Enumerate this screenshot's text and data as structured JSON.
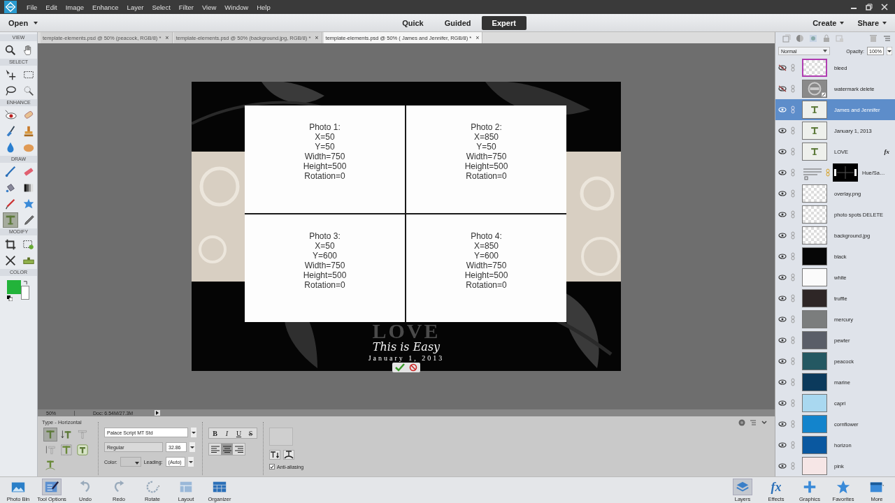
{
  "menu_bar": {
    "items": [
      "File",
      "Edit",
      "Image",
      "Enhance",
      "Layer",
      "Select",
      "Filter",
      "View",
      "Window",
      "Help"
    ]
  },
  "mode_bar": {
    "open": "Open",
    "modes": [
      {
        "label": "Quick",
        "selected": false
      },
      {
        "label": "Guided",
        "selected": false
      },
      {
        "label": "Expert",
        "selected": true
      }
    ],
    "create": "Create",
    "share": "Share"
  },
  "toolbox": {
    "sections": [
      {
        "title": "VIEW",
        "tools": [
          {
            "kind": "zoom",
            "selected": false
          },
          {
            "kind": "hand",
            "selected": false
          }
        ]
      },
      {
        "title": "SELECT",
        "tools": [
          {
            "kind": "move",
            "selected": false
          },
          {
            "kind": "marquee",
            "selected": false
          },
          {
            "kind": "lasso",
            "selected": false
          },
          {
            "kind": "quick-select",
            "selected": false
          }
        ]
      },
      {
        "title": "ENHANCE",
        "tools": [
          {
            "kind": "red-eye",
            "selected": false
          },
          {
            "kind": "spot-heal",
            "selected": false
          },
          {
            "kind": "smart-brush",
            "selected": false
          },
          {
            "kind": "clone-stamp",
            "selected": false
          },
          {
            "kind": "blur",
            "selected": false
          },
          {
            "kind": "sponge",
            "selected": false
          }
        ]
      },
      {
        "title": "DRAW",
        "tools": [
          {
            "kind": "brush",
            "selected": false
          },
          {
            "kind": "eraser",
            "selected": false
          },
          {
            "kind": "paint-bucket",
            "selected": false
          },
          {
            "kind": "gradient",
            "selected": false
          },
          {
            "kind": "eyedropper",
            "selected": false
          },
          {
            "kind": "custom-shape",
            "selected": false
          },
          {
            "kind": "type",
            "selected": true
          },
          {
            "kind": "pencil",
            "selected": false
          }
        ]
      },
      {
        "title": "MODIFY",
        "tools": [
          {
            "kind": "crop",
            "selected": false
          },
          {
            "kind": "recompose",
            "selected": false
          },
          {
            "kind": "content-move",
            "selected": false
          },
          {
            "kind": "straighten",
            "selected": false
          }
        ]
      }
    ],
    "color_title": "COLOR",
    "swatches": [
      {
        "kind": "foreground",
        "color": "#22b33a"
      },
      {
        "kind": "background",
        "color": "#ffffff"
      }
    ]
  },
  "document_tabs": [
    {
      "label": "template-elements.psd @ 50% (peacock, RGB/8) *",
      "close": "×",
      "selected": false
    },
    {
      "label": "template-elements.psd @ 50% (background.jpg, RGB/8) *",
      "close": "×",
      "selected": false
    },
    {
      "label": "template-elements.psd @ 50% ( James and Jennifer, RGB/8) *",
      "close": "×",
      "selected": true
    }
  ],
  "canvas": {
    "photo_spots": [
      {
        "lines": [
          "Photo 1:",
          "X=50",
          "Y=50",
          "Width=750",
          "Height=500",
          "Rotation=0"
        ]
      },
      {
        "lines": [
          "Photo 2:",
          "X=850",
          "Y=50",
          "Width=750",
          "Height=500",
          "Rotation=0"
        ]
      },
      {
        "lines": [
          "Photo 3:",
          "X=50",
          "Y=600",
          "Width=750",
          "Height=500",
          "Rotation=0"
        ]
      },
      {
        "lines": [
          "Photo 4:",
          "X=850",
          "Y=600",
          "Width=750",
          "Height=500",
          "Rotation=0"
        ]
      }
    ],
    "title_text": "LOVE",
    "script_text": "This is Easy",
    "date_text": "January 1, 2013"
  },
  "status": {
    "zoom": "50%",
    "doc": "Doc: 6.54M/27.3M"
  },
  "tool_options": {
    "title": "Type - Horizontal",
    "type_tools": [
      {
        "kind": "horizontal",
        "selected": true
      },
      {
        "kind": "vertical",
        "selected": false
      },
      {
        "kind": "horizontal-mask",
        "selected": false
      },
      {
        "kind": "vertical-mask",
        "selected": false
      },
      {
        "kind": "on-selection",
        "selected": false
      },
      {
        "kind": "on-shape",
        "selected": false
      },
      {
        "kind": "on-path",
        "selected": false
      }
    ],
    "font": "Palace Script MT Std",
    "style": "Regular",
    "size": "32.86",
    "styles": [
      {
        "label": "B",
        "selected": false
      },
      {
        "label": "I",
        "selected": false
      },
      {
        "label": "U",
        "selected": false
      },
      {
        "label": "S",
        "selected": false
      }
    ],
    "alignments": [
      {
        "kind": "left",
        "selected": false
      },
      {
        "kind": "center",
        "selected": true
      },
      {
        "kind": "right",
        "selected": false
      }
    ],
    "color_label": "Color:",
    "leading_label": "Leading:",
    "leading": "(Auto)",
    "anti_aliasing": {
      "label": "Anti-aliasing",
      "checked": true
    }
  },
  "layers_panel": {
    "blend_mode": "Normal",
    "opacity_label": "Opacity:",
    "opacity": "100%",
    "layers": [
      {
        "name": "bleed",
        "kind": "outlined",
        "visible": false,
        "selected": false
      },
      {
        "name": "watermark delete",
        "kind": "smart-object",
        "visible": false,
        "selected": false
      },
      {
        "name": "James and Jennifer",
        "kind": "text",
        "visible": true,
        "selected": true
      },
      {
        "name": "January 1, 2013",
        "kind": "text",
        "visible": true,
        "selected": false
      },
      {
        "name": "LOVE",
        "kind": "text",
        "visible": true,
        "selected": false,
        "effects": "fx"
      },
      {
        "name": "Hue/Sa…",
        "kind": "adjustment",
        "visible": true,
        "selected": false
      },
      {
        "name": "overlay.png",
        "kind": "checker",
        "visible": true,
        "selected": false
      },
      {
        "name": "photo spots DELETE",
        "kind": "checker",
        "visible": true,
        "selected": false
      },
      {
        "name": "background.jpg",
        "kind": "checker",
        "visible": true,
        "selected": false
      },
      {
        "name": "black",
        "kind": "swatch",
        "color": "#060606",
        "visible": true,
        "selected": false
      },
      {
        "name": "white",
        "kind": "swatch",
        "color": "#fbfbfb",
        "visible": true,
        "selected": false
      },
      {
        "name": "truffle",
        "kind": "swatch",
        "color": "#2e2626",
        "visible": true,
        "selected": false
      },
      {
        "name": "mercury",
        "kind": "swatch",
        "color": "#7b7d7d",
        "visible": true,
        "selected": false
      },
      {
        "name": "pewter",
        "kind": "swatch",
        "color": "#5a5e68",
        "visible": true,
        "selected": false
      },
      {
        "name": "peacock",
        "kind": "swatch",
        "color": "#245862",
        "visible": true,
        "selected": false
      },
      {
        "name": "marine",
        "kind": "swatch",
        "color": "#0b3a5c",
        "visible": true,
        "selected": false
      },
      {
        "name": "capri",
        "kind": "swatch",
        "color": "#a9d8f0",
        "visible": true,
        "selected": false
      },
      {
        "name": "cornflower",
        "kind": "swatch",
        "color": "#1384cc",
        "visible": true,
        "selected": false
      },
      {
        "name": "horizon",
        "kind": "swatch",
        "color": "#0a58a0",
        "visible": true,
        "selected": false
      },
      {
        "name": "pink",
        "kind": "swatch",
        "color": "#f6e6e6",
        "visible": true,
        "selected": false
      }
    ]
  },
  "bottom_bar": {
    "left": [
      {
        "label": "Photo Bin",
        "kind": "photo-bin",
        "selected": false
      },
      {
        "label": "Tool Options",
        "kind": "tool-options",
        "selected": true
      },
      {
        "label": "Undo",
        "kind": "undo",
        "selected": false
      },
      {
        "label": "Redo",
        "kind": "redo",
        "selected": false
      },
      {
        "label": "Rotate",
        "kind": "rotate",
        "selected": false
      },
      {
        "label": "Layout",
        "kind": "layout",
        "selected": false
      },
      {
        "label": "Organizer",
        "kind": "organizer",
        "selected": false
      }
    ],
    "right": [
      {
        "label": "Layers",
        "kind": "layers",
        "selected": true
      },
      {
        "label": "Effects",
        "kind": "effects",
        "glyph": "fx",
        "selected": false
      },
      {
        "label": "Graphics",
        "kind": "graphics",
        "selected": false
      },
      {
        "label": "Favorites",
        "kind": "favorites",
        "selected": false
      },
      {
        "label": "More",
        "kind": "more",
        "selected": false
      }
    ]
  }
}
